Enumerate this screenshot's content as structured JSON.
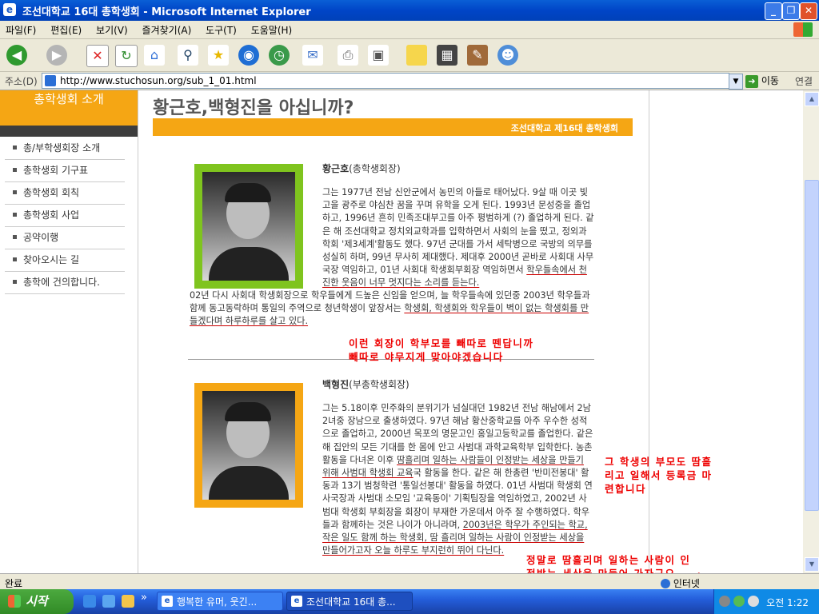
{
  "window": {
    "title": "조선대학교 16대 총학생회 - Microsoft Internet Explorer",
    "ie_logo": "e",
    "minimize": "_",
    "restore": "❐",
    "close": "✕"
  },
  "menu": [
    "파일(F)",
    "편집(E)",
    "보기(V)",
    "즐겨찾기(A)",
    "도구(T)",
    "도움말(H)"
  ],
  "address": {
    "label": "주소(D)",
    "url": "http://www.stuchosun.org/sub_1_01.html",
    "go_label": "이동",
    "links_label": "연결"
  },
  "sidebar": {
    "header": "총학생회 소개",
    "items": [
      "총/부학생회장 소개",
      "총학생회 기구표",
      "총학생회 회칙",
      "총학생회 사업",
      "공약이행",
      "찾아오시는 길",
      "총학에 건의합니다."
    ]
  },
  "main": {
    "title": "황근호,백형진을 아십니까?",
    "banner": "조선대학교 제16대 총학생회",
    "president": {
      "name": "황근호",
      "role": "(총학생회장)",
      "bio_a": "그는 1977년 전남 신안군에서 농민의 아들로 태어났다. 9살 때 이곳 빛고을 광주로 야심찬 꿈을 꾸며 유학을 오게 된다. 1993년 문성중을 졸업하고, 1996년 흔히 민족조대부고를 아주 평범하게 (?) 졸업하게 된다. 같은 해 조선대학교 정치외교학과를 입학하면서 사회의 눈을 떴고, 정외과 학회 '제3세계'활동도 했다. 97년 군대를 가서 세탁병으로 국방의 의무를 성실히 하며, 99년 무사히 제대했다. 제대후 2000년 곧바로 사회대 사무국장 역임하고, 01년 사회대 학생회부회장 역임하면서 ",
      "bio_u1": "학우들속에서 천진한 웃음이 너무 멋지다는 소리를 듣는다.",
      "bio_b": " 02년 다시 사회대 학생회장으로 학우들에게 드높은 신임을 얻으며, 늘 학우들속에 있던중 2003년 학우들과 함께 동고동락하며 통일의 주역으로 청년학생이 앞장서는 ",
      "bio_u2": "학생회, 학생회와 학우들이 벽이 없는 학생회를 만들겠다며 하루하루를 살고 있다."
    },
    "vice_president": {
      "name": "백형진",
      "role": "(부총학생회장)",
      "bio_a": "그는 5.18이후 민주화의 분위기가 넘실대던 1982년 전남 해남에서 2남 2녀중 장남으로 출생하였다. 97년 해남 황산중학교를 아주 우수한 성적으로 졸업하고, 2000년 목포의 명문고인 홍일고등학교를 졸업한다. 같은 해 집안의 모든 기대를 한 몸에 안고 사범대 과학교육학부 입학한다. 농촌활동을 다녀온 이후 ",
      "bio_u1": "땀흘리며 일하는 사람들이 인정받는 세상을 만들기 위해 사범대 학생회 교육",
      "bio_b": "국 활동을 한다. 같은 해 한총련 '반미전봉대' 활동과 13기 범청학련 '통일선봉대' 활동을 하였다. 01년 사범대 학생회 연사국장과 사범대 소모임 '교육동이' 기획팀장을 역임하였고, 2002년 사범대 학생회 부회장을 회장이 부재한 가운데서 아주 잘 수행하였다. 학우들과 함께하는 것은 나이가 아니라며, ",
      "bio_u2": "2003년은 학우가 주인되는 학교, 작은 일도 함께 하는 학생회, 땀 흘리며 일하는 사람이 인정받는 세상을 만들어가고자 오늘 하루도 부지런히 뛰어 다닌다."
    }
  },
  "annotations": {
    "first": "이런 회장이 학부모를 빼따로 뗀답니까\n빼따로 야무지게 맞아야겠습니다",
    "second": "그 학생의 부모도 땀흘\n리고 일해서 등록금 마\n련합니다",
    "third": "정말로 땀흘리며 일하는 사람이 인\n정받는 세상을 만들어 가자구요 -_-;"
  },
  "status": {
    "text": "완료",
    "zone": "인터넷"
  },
  "taskbar": {
    "start": "시작",
    "chevron": "»",
    "tasks": [
      "행복한 유머, 웃긴...",
      "조선대학교 16대 총..."
    ],
    "clock": "오전 1:22"
  }
}
